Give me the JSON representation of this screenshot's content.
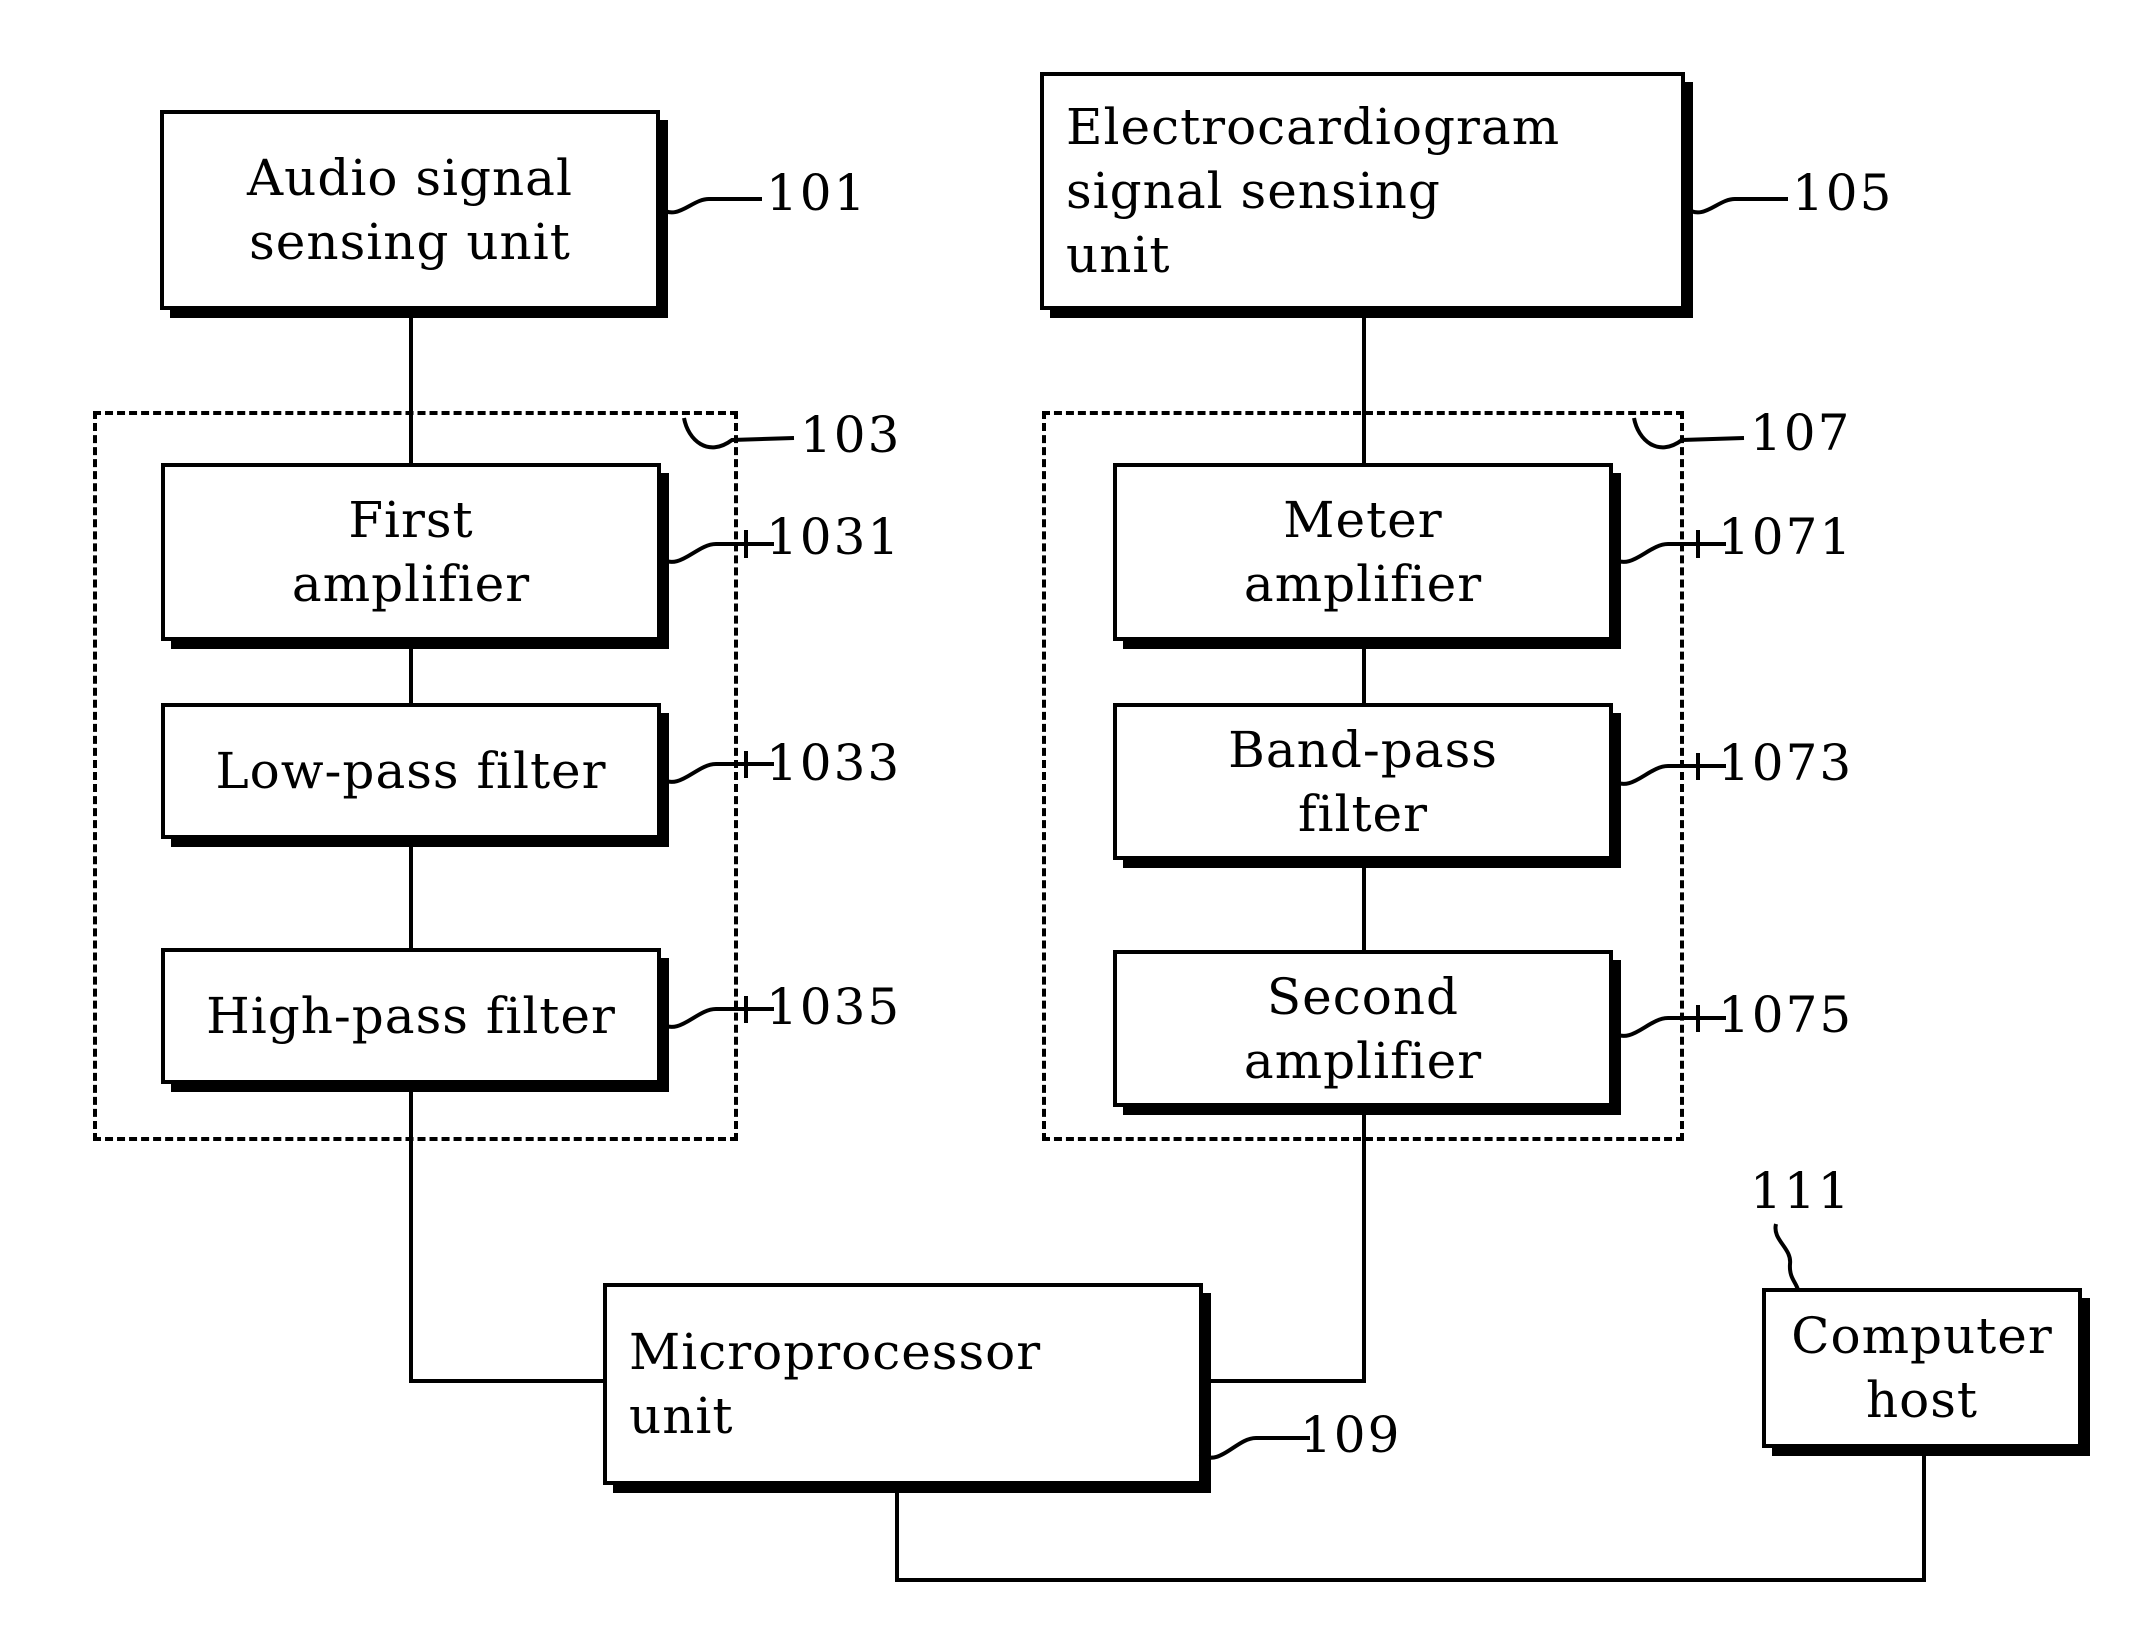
{
  "figure": {
    "type": "block-diagram",
    "title": "",
    "blocks": [
      {
        "id": "audio_sensing",
        "label": "Audio signal\nsensing unit",
        "ref": "101"
      },
      {
        "id": "ecg_sensing",
        "label": "Electrocardiogram\nsignal sensing\nunit",
        "ref": "105"
      },
      {
        "id": "first_amplifier",
        "label": "First\namplifier",
        "ref": "1031"
      },
      {
        "id": "low_pass",
        "label": "Low-pass filter",
        "ref": "1033"
      },
      {
        "id": "high_pass",
        "label": "High-pass filter",
        "ref": "1035"
      },
      {
        "id": "meter_amplifier",
        "label": "Meter\namplifier",
        "ref": "1071"
      },
      {
        "id": "band_pass",
        "label": "Band-pass\nfilter",
        "ref": "1073"
      },
      {
        "id": "second_amplifier",
        "label": "Second\namplifier",
        "ref": "1075"
      },
      {
        "id": "microprocessor",
        "label": "Microprocessor\nunit",
        "ref": "109"
      },
      {
        "id": "computer_host",
        "label": "Computer\nhost",
        "ref": "111"
      }
    ],
    "groups": [
      {
        "id": "audio_processing",
        "ref": "103"
      },
      {
        "id": "ecg_processing",
        "ref": "107"
      }
    ],
    "refs": {
      "r101": "101",
      "r103": "103",
      "r1031": "1031",
      "r1033": "1033",
      "r1035": "1035",
      "r105": "105",
      "r107": "107",
      "r1071": "1071",
      "r1073": "1073",
      "r1075": "1075",
      "r109": "109",
      "r111": "111"
    },
    "labels": {
      "audio_sensing": "Audio signal\nsensing unit",
      "ecg_sensing": "Electrocardiogram\nsignal sensing\nunit",
      "first_amplifier": "First\namplifier",
      "low_pass": "Low-pass filter",
      "high_pass": "High-pass filter",
      "meter_amplifier": "Meter\namplifier",
      "band_pass": "Band-pass\nfilter",
      "second_amplifier": "Second\namplifier",
      "microprocessor": "Microprocessor\nunit",
      "computer_host": "Computer\nhost"
    },
    "colors": {
      "ink": "#000000",
      "paper": "#ffffff"
    }
  }
}
